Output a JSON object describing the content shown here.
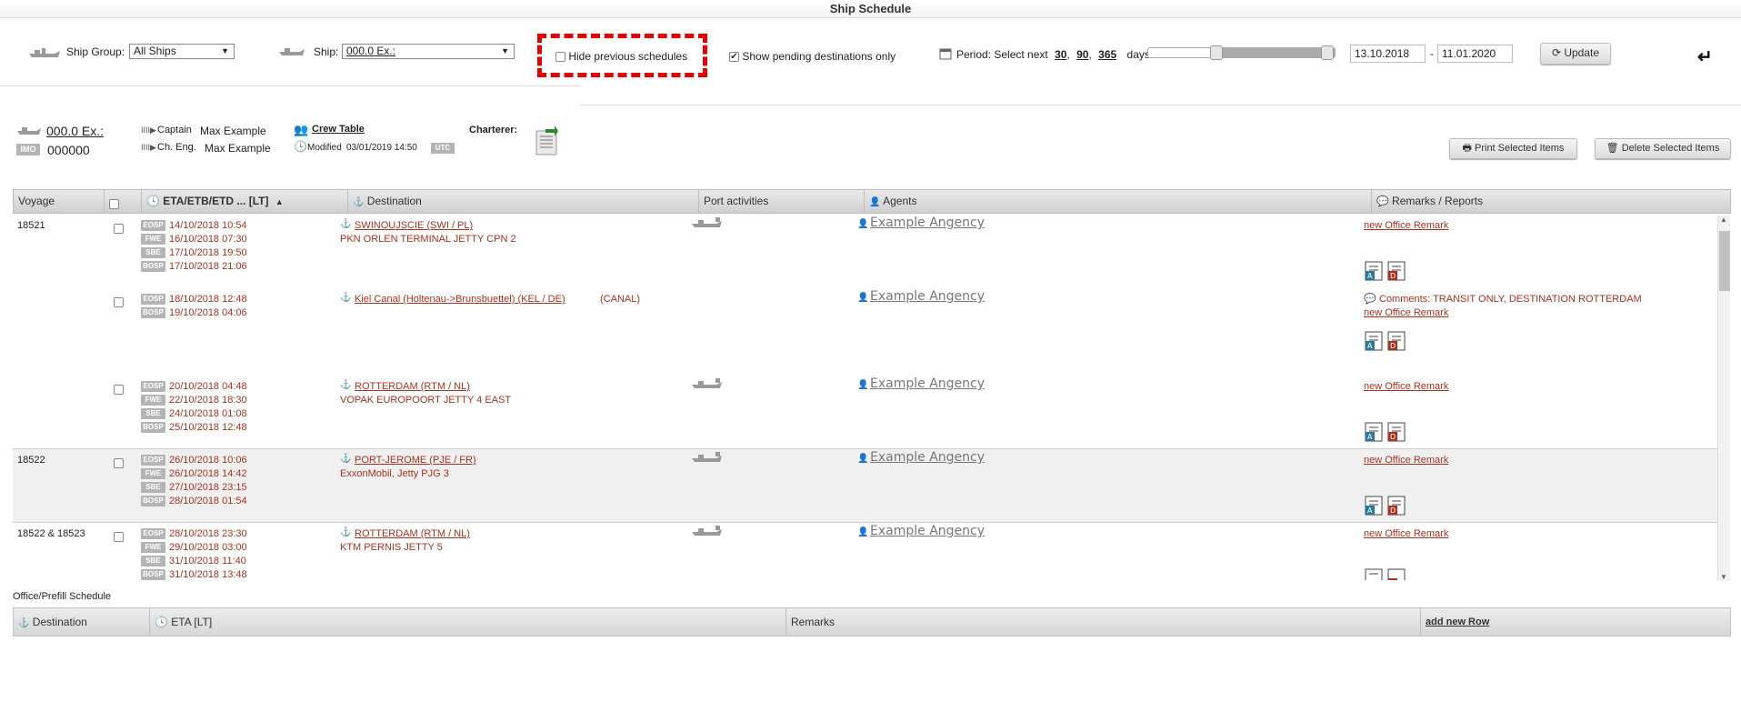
{
  "window": {
    "title": "Ship Schedule"
  },
  "toolbar": {
    "ship_group_label": "Ship Group:",
    "ship_group_value": "All Ships",
    "ship_label": "Ship:",
    "ship_value": "000.0 Ex.:",
    "hide_previous_label": "Hide previous schedules",
    "hide_previous_checked": false,
    "pending_label": "Show pending destinations only",
    "pending_checked": true,
    "period_label": "Period: Select next",
    "period_opt1": "30",
    "period_opt2": "90",
    "period_opt3": "365",
    "days_label": "days",
    "date_from": "13.10.2018",
    "date_sep": "-",
    "date_to": "11.01.2020",
    "update_label": "Update"
  },
  "ship_info": {
    "name": "000.0 Ex.:",
    "imo_badge": "IMO",
    "imo": "000000",
    "captain_label": "Captain",
    "captain": "Max Example",
    "ch_eng_label": "Ch. Eng.",
    "ch_eng": "Max Example",
    "crew_table": "Crew Table",
    "modified_label": "Modified",
    "modified_value": "03/01/2019 14:50",
    "utc_badge": "UTC",
    "charterer_label": "Charterer:",
    "print_label": "Print Selected Items",
    "delete_label": "Delete Selected Items"
  },
  "table": {
    "columns": {
      "voyage": "Voyage",
      "eta": "ETA/ETB/ETD ... [LT]",
      "destination": "Destination",
      "port_activities": "Port activities",
      "agents": "Agents",
      "remarks": "Remarks / Reports"
    },
    "rows": [
      {
        "voyage": "18521",
        "times": [
          {
            "tag": "EOSP",
            "value": "14/10/2018 10:54"
          },
          {
            "tag": "FWE",
            "value": "16/10/2018 07:30"
          },
          {
            "tag": "SBE",
            "value": "17/10/2018 19:50"
          },
          {
            "tag": "BOSP",
            "value": "17/10/2018 21:06"
          }
        ],
        "dest_link": "SWINOUJSCIE (SWI / PL)",
        "dest_extra": "",
        "terminal": "PKN ORLEN TERMINAL JETTY CPN 2",
        "agent": "Example Angency",
        "comment": "",
        "remark_link": "new Office Remark"
      },
      {
        "voyage": "",
        "times": [
          {
            "tag": "EOSP",
            "value": "18/10/2018 12:48"
          },
          {
            "tag": "BOSP",
            "value": "19/10/2018 04:06"
          }
        ],
        "dest_link": "Kiel Canal (Holtenau->Brunsbuettel) (KEL / DE)",
        "dest_extra": "(CANAL)",
        "terminal": "",
        "agent": "Example Angency",
        "comment": "Comments: TRANSIT ONLY, DESTINATION ROTTERDAM",
        "remark_link": "new Office Remark"
      },
      {
        "voyage": "",
        "times": [
          {
            "tag": "EOSP",
            "value": "20/10/2018 04:48"
          },
          {
            "tag": "FWE",
            "value": "22/10/2018 18:30"
          },
          {
            "tag": "SBE",
            "value": "24/10/2018 01:08"
          },
          {
            "tag": "BOSP",
            "value": "25/10/2018 12:48"
          }
        ],
        "dest_link": "ROTTERDAM (RTM / NL)",
        "dest_extra": "",
        "terminal": "VOPAK EUROPOORT JETTY 4 EAST",
        "agent": "Example Angency",
        "comment": "",
        "remark_link": "new Office Remark"
      },
      {
        "voyage": "18522",
        "times": [
          {
            "tag": "EOSP",
            "value": "26/10/2018 10:06"
          },
          {
            "tag": "FWE",
            "value": "26/10/2018 14:42"
          },
          {
            "tag": "SBE",
            "value": "27/10/2018 23:15"
          },
          {
            "tag": "BOSP",
            "value": "28/10/2018 01:54"
          }
        ],
        "dest_link": "PORT-JEROME (PJE / FR)",
        "dest_extra": "",
        "terminal": "ExxonMobil, Jetty PJG 3",
        "agent": "Example Angency",
        "comment": "",
        "remark_link": "new Office Remark"
      },
      {
        "voyage": "18522 & 18523",
        "times": [
          {
            "tag": "EOSP",
            "value": "28/10/2018 23:30"
          },
          {
            "tag": "FWE",
            "value": "29/10/2018 03:00"
          },
          {
            "tag": "SBE",
            "value": "31/10/2018 11:40"
          },
          {
            "tag": "BOSP",
            "value": "31/10/2018 13:48"
          }
        ],
        "dest_link": "ROTTERDAM (RTM / NL)",
        "dest_extra": "",
        "terminal": "KTM PERNIS JETTY 5",
        "agent": "Example Angency",
        "comment": "",
        "remark_link": "new Office Remark"
      }
    ]
  },
  "office": {
    "title": "Office/Prefill Schedule",
    "col_destination": "Destination",
    "col_eta": "ETA [LT]",
    "col_remarks": "Remarks",
    "add_row": "add new Row"
  },
  "colors": {
    "accent_red": "#a8321e",
    "highlight": "#e60000"
  }
}
